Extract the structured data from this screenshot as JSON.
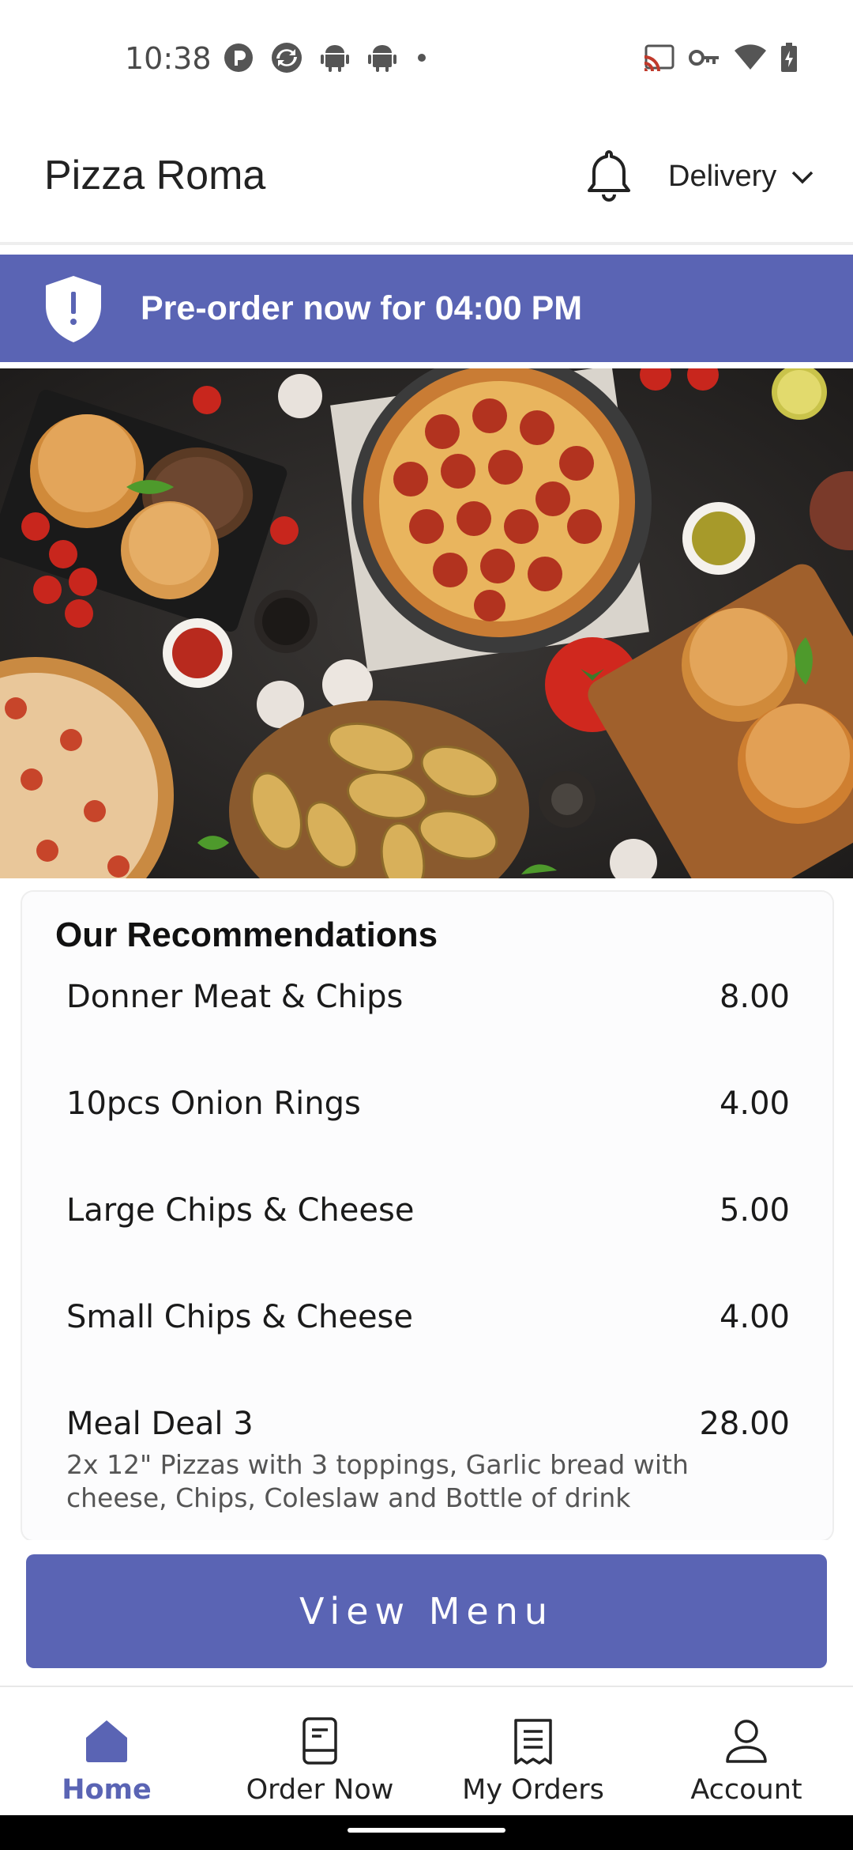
{
  "status_bar": {
    "time": "10:38",
    "left_icons": [
      "p-circle-icon",
      "sync-icon",
      "android-icon",
      "android-icon",
      "dot-icon"
    ],
    "right_icons": [
      "cast-icon",
      "vpn-key-icon",
      "wifi-icon",
      "battery-icon"
    ]
  },
  "app_bar": {
    "title": "Pizza Roma",
    "notification_icon": "bell-icon",
    "order_type": "Delivery",
    "order_type_icon": "chevron-down-icon"
  },
  "banner": {
    "icon": "shield-alert-icon",
    "text": "Pre-order now for 04:00 PM",
    "color": "#5a64b4"
  },
  "hero": {
    "image": "pizza-burger-food-spread"
  },
  "recommendations": {
    "title": "Our Recommendations",
    "items": [
      {
        "name": "Donner Meat & Chips",
        "price": "8.00",
        "description": ""
      },
      {
        "name": "10pcs Onion Rings",
        "price": "4.00",
        "description": ""
      },
      {
        "name": "Large Chips & Cheese",
        "price": "5.00",
        "description": ""
      },
      {
        "name": "Small Chips & Cheese",
        "price": "4.00",
        "description": ""
      },
      {
        "name": "Meal Deal 3",
        "price": "28.00",
        "description": "2x 12\" Pizzas with 3 toppings, Garlic bread with cheese, Chips, Coleslaw and Bottle of drink"
      }
    ]
  },
  "view_menu_button": {
    "label": "View Menu"
  },
  "bottom_nav": {
    "active_color": "#5a64b4",
    "items": [
      {
        "label": "Home",
        "icon": "home-icon",
        "active": true
      },
      {
        "label": "Order Now",
        "icon": "order-now-icon",
        "active": false
      },
      {
        "label": "My Orders",
        "icon": "receipt-icon",
        "active": false
      },
      {
        "label": "Account",
        "icon": "person-icon",
        "active": false
      }
    ]
  }
}
